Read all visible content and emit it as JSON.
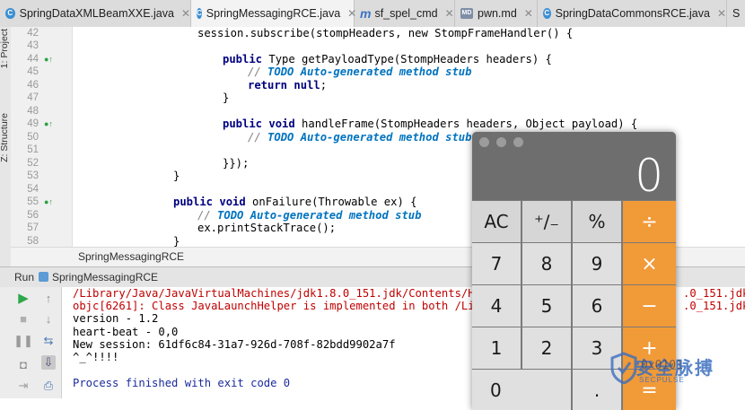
{
  "tabs": [
    {
      "label": "SpringDataXMLBeamXXE.java",
      "icon": "java-class-icon",
      "active": false
    },
    {
      "label": "SpringMessagingRCE.java",
      "icon": "java-class-icon",
      "active": true
    },
    {
      "label": "sf_spel_cmd",
      "icon": "m-file-icon",
      "active": false
    },
    {
      "label": "pwn.md",
      "icon": "markdown-icon",
      "active": false
    },
    {
      "label": "SpringDataCommonsRCE.java",
      "icon": "java-class-icon",
      "active": false
    },
    {
      "label": "S",
      "icon": "java-class-icon",
      "active": false
    }
  ],
  "tool_windows": {
    "project": "1: Project",
    "structure": "Z: Structure"
  },
  "line_numbers": [
    "42",
    "43",
    "44",
    "45",
    "46",
    "47",
    "48",
    "49",
    "50",
    "51",
    "52",
    "53",
    "54",
    "55",
    "56",
    "57",
    "58"
  ],
  "code": {
    "l42": "session.subscribe(stompHeaders, new StompFrameHandler() {",
    "l44a": "public",
    "l44b": " Type getPayloadType(StompHeaders headers) {",
    "l45a": "// ",
    "l45b": "TODO Auto-generated method stub",
    "l46a": "return null",
    "l46b": ";",
    "l47": "}",
    "l49a": "public void",
    "l49b": " handleFrame(StompHeaders headers, Object payload) {",
    "l50a": "// ",
    "l50b": "TODO Auto-generated method stub",
    "l52": "}});",
    "l53": "}",
    "l55a": "public void",
    "l55b": " onFailure(Throwable ex) {",
    "l56a": "// ",
    "l56b": "TODO Auto-generated method stub",
    "l57": "ex.printStackTrace();",
    "l58": "}"
  },
  "breadcrumb": "SpringMessagingRCE",
  "run": {
    "label": "Run",
    "config": "SpringMessagingRCE",
    "console": [
      "/Library/Java/JavaVirtualMachines/jdk1.8.0_151.jdk/Contents/Home/",
      "objc[6261]: Class JavaLaunchHelper is implemented in both /Librar",
      "version - 1.2",
      "heart-beat - 0,0",
      "New session: 61df6c84-31a7-926d-708f-82bdd9902a7f",
      "^_^!!!!",
      "",
      "Process finished with exit code 0"
    ],
    "console_tail_1": ".0_151.jdk/C",
    "console_tail_2": ".0_151.jdk/C"
  },
  "calculator": {
    "display": "0",
    "keys": {
      "ac": "AC",
      "sign": "⁺∕₋",
      "percent": "%",
      "divide": "÷",
      "k7": "7",
      "k8": "8",
      "k9": "9",
      "multiply": "×",
      "k4": "4",
      "k5": "5",
      "k6": "6",
      "minus": "−",
      "k1": "1",
      "k2": "2",
      "k3": "3",
      "plus": "+",
      "k0": "0",
      "dot": ".",
      "equals": "="
    }
  },
  "watermark": {
    "title": "安全脉搏",
    "sub": "SECPULSE",
    "overlay": "0x0101"
  },
  "colors": {
    "accent_orange": "#f19a38",
    "keyword": "#000080",
    "todo": "#0073bf",
    "error": "#c00000"
  }
}
